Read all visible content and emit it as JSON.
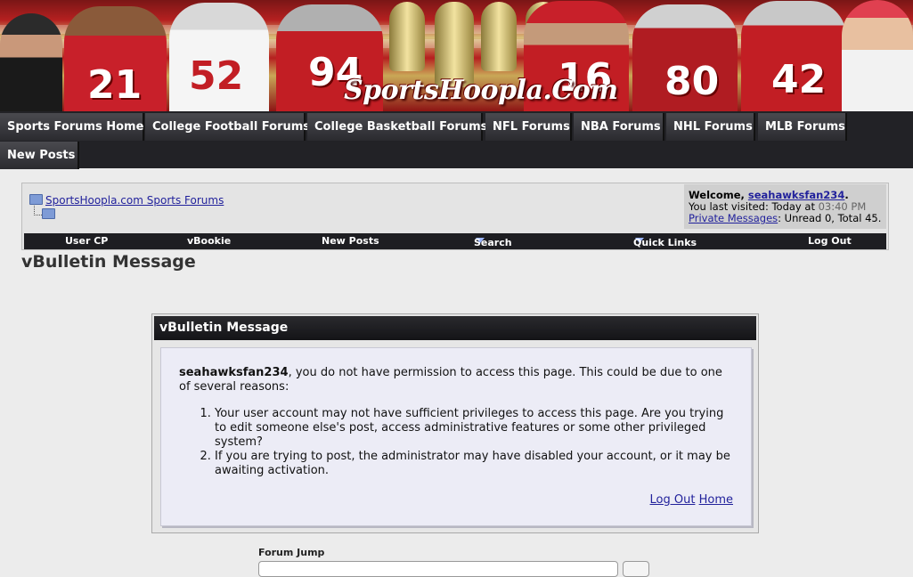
{
  "banner": {
    "brand_text": "SportsHoopla.Com",
    "jersey_numbers": [
      "21",
      "52",
      "94",
      "16",
      "80",
      "42"
    ]
  },
  "nav": {
    "tabs": [
      {
        "label": "Sports Forums Home"
      },
      {
        "label": "College Football Forums"
      },
      {
        "label": "College Basketball Forums"
      },
      {
        "label": "NFL Forums"
      },
      {
        "label": "NBA Forums"
      },
      {
        "label": "NHL Forums"
      },
      {
        "label": "MLB Forums"
      },
      {
        "label": "New Posts"
      }
    ]
  },
  "header": {
    "breadcrumb": "SportsHoopla.com Sports Forums",
    "welcome_prefix": "Welcome, ",
    "username": "seahawksfan234",
    "welcome_suffix": ".",
    "last_visited_prefix": "You last visited: Today at ",
    "last_visited_time": "03:40 PM",
    "pm_link": "Private Messages",
    "pm_status": ": Unread 0, Total 45."
  },
  "subnav": {
    "user_cp": "User CP",
    "vbookie": "vBookie",
    "new_posts": "New Posts",
    "search": "Search",
    "quick_links": "Quick Links",
    "log_out": "Log Out"
  },
  "page_title": "vBulletin Message",
  "message": {
    "title": "vBulletin Message",
    "username": "seahawksfan234",
    "intro": ", you do not have permission to access this page. This could be due to one of several reasons:",
    "reasons": [
      "Your user account may not have sufficient privileges to access this page. Are you trying to edit someone else's post, access administrative features or some other privileged system?",
      "If you are trying to post, the administrator may have disabled your account, or it may be awaiting activation."
    ],
    "log_out_link": "Log Out",
    "home_link": "Home"
  },
  "forum_jump": {
    "label": "Forum Jump"
  },
  "colors": {
    "nav_bg": "#222226",
    "link": "#22229c",
    "panel_head": "#141417"
  }
}
